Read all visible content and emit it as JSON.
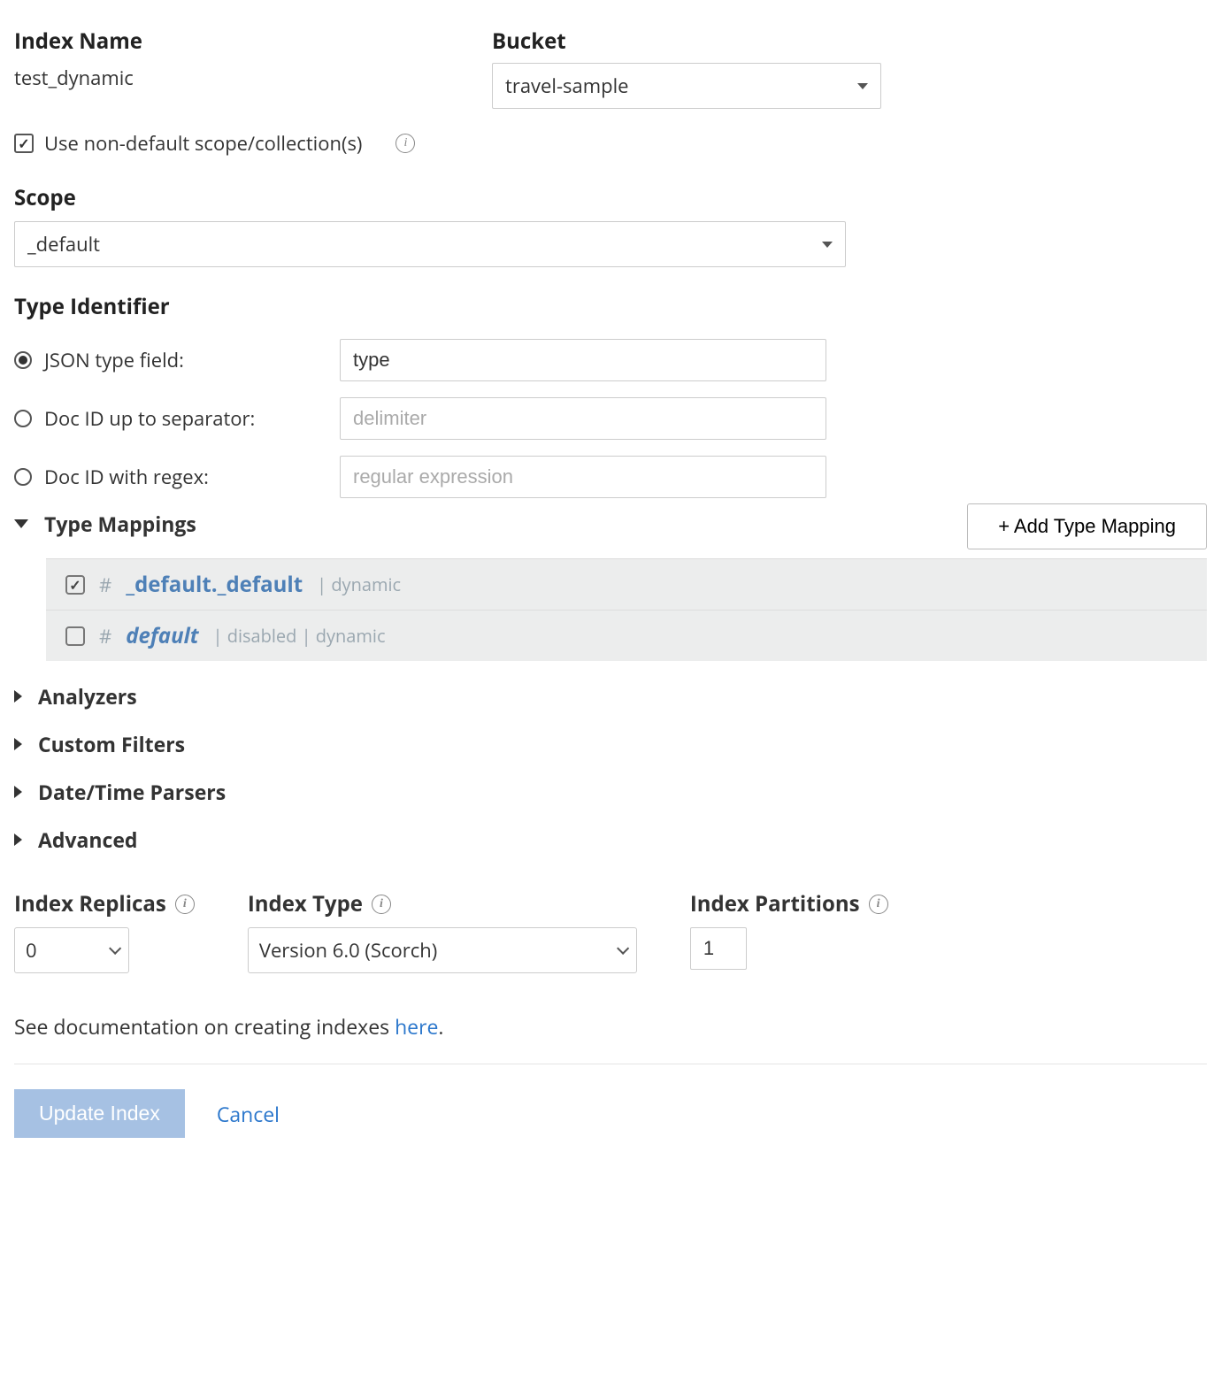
{
  "labels": {
    "index_name": "Index Name",
    "bucket": "Bucket",
    "scope": "Scope",
    "type_identifier": "Type Identifier",
    "use_non_default": "Use non-default scope/collection(s)",
    "json_type_field": "JSON type field:",
    "doc_id_sep": "Doc ID up to separator:",
    "doc_id_regex": "Doc ID with regex:",
    "type_mappings": "Type Mappings",
    "add_type_mapping": "+ Add Type Mapping",
    "analyzers": "Analyzers",
    "custom_filters": "Custom Filters",
    "datetime_parsers": "Date/Time Parsers",
    "advanced": "Advanced",
    "index_replicas": "Index Replicas",
    "index_type": "Index Type",
    "index_partitions": "Index Partitions",
    "doc_text_pre": "See documentation on creating indexes ",
    "doc_text_link": "here",
    "doc_text_post": ".",
    "update_index": "Update Index",
    "cancel": "Cancel"
  },
  "values": {
    "index_name": "test_dynamic",
    "bucket": "travel-sample",
    "scope": "_default",
    "json_type_field_value": "type",
    "index_replicas": "0",
    "index_type": "Version 6.0 (Scorch)",
    "index_partitions": "1"
  },
  "placeholders": {
    "delimiter": "delimiter",
    "regex": "regular expression"
  },
  "mappings": [
    {
      "checked": true,
      "name": "_default._default",
      "italic": false,
      "meta": "| dynamic"
    },
    {
      "checked": false,
      "name": "default",
      "italic": true,
      "meta": "| disabled | dynamic"
    }
  ]
}
